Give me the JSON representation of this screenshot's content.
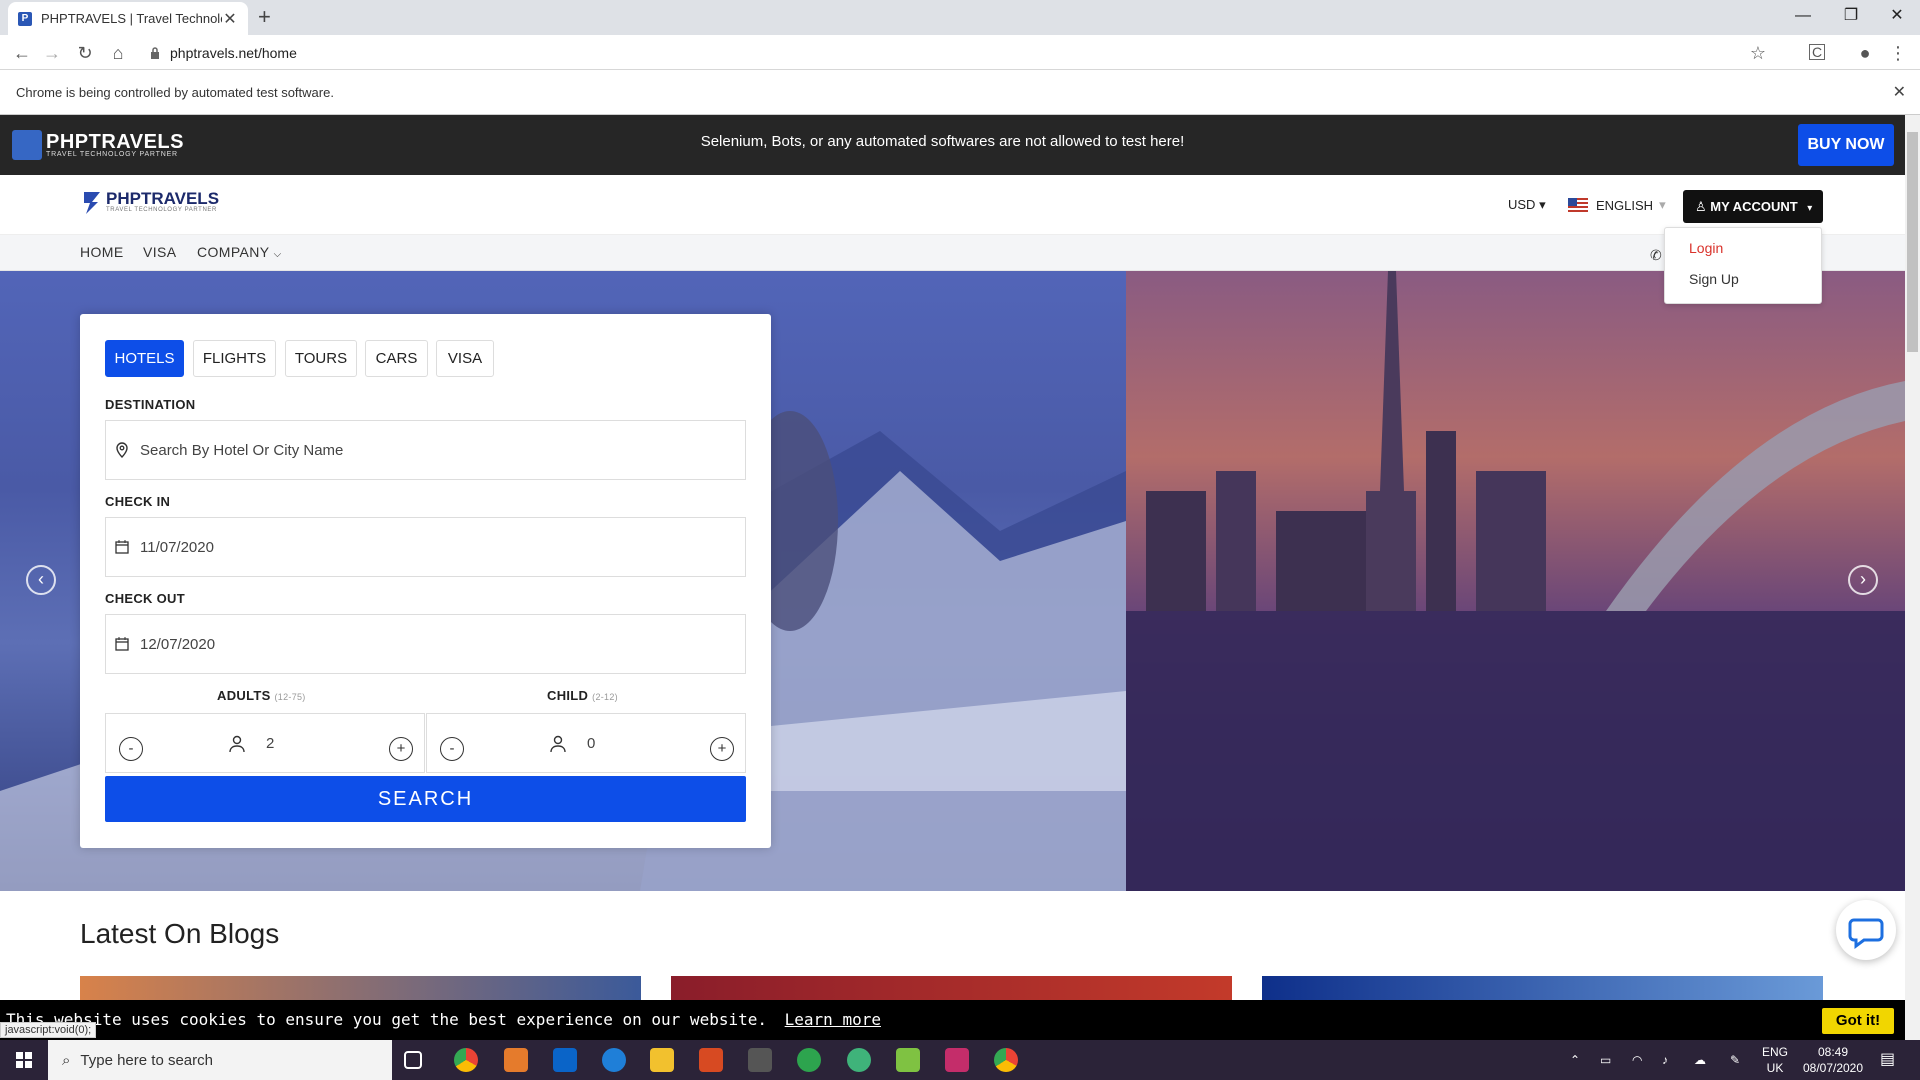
{
  "browser": {
    "tab_title": "PHPTRAVELS | Travel Technology",
    "url": "phptravels.net/home",
    "infobar_text": "Chrome is being controlled by automated test software."
  },
  "site": {
    "banner_logo": "PHPTRAVELS",
    "banner_logo_sub": "TRAVEL TECHNOLOGY PARTNER",
    "banner_message": "Selenium, Bots, or any automated softwares are not allowed to test here!",
    "buy_now": "BUY NOW",
    "header_logo": "PHPTRAVELS",
    "header_logo_sub": "TRAVEL TECHNOLOGY PARTNER",
    "currency": "USD",
    "language": "ENGLISH",
    "my_account": "MY ACCOUNT",
    "dropdown": {
      "login": "Login",
      "signup": "Sign Up"
    },
    "nav": {
      "home": "HOME",
      "visa": "VISA",
      "company": "COMPANY"
    }
  },
  "search": {
    "tabs": [
      "HOTELS",
      "FLIGHTS",
      "TOURS",
      "CARS",
      "VISA"
    ],
    "destination_label": "DESTINATION",
    "destination_placeholder": "Search By Hotel Or City Name",
    "checkin_label": "CHECK IN",
    "checkin_value": "11/07/2020",
    "checkout_label": "CHECK OUT",
    "checkout_value": "12/07/2020",
    "adults_label": "ADULTS",
    "adults_range": "(12-75)",
    "adults_value": "2",
    "child_label": "CHILD",
    "child_range": "(2-12)",
    "child_value": "0",
    "search_button": "SEARCH"
  },
  "blogs_title": "Latest On Blogs",
  "cookie": {
    "text": "This website uses cookies to ensure you get the best experience on our website.",
    "learn_more": "Learn more",
    "got_it": "Got it!"
  },
  "status_url": "javascript:void(0);",
  "taskbar": {
    "search_placeholder": "Type here to search",
    "lang": "ENG",
    "lang_region": "UK",
    "time": "08:49",
    "date": "08/07/2020"
  },
  "colors": {
    "accent": "#0d4ee8",
    "banner": "#262626",
    "login_red": "#d9322b"
  }
}
